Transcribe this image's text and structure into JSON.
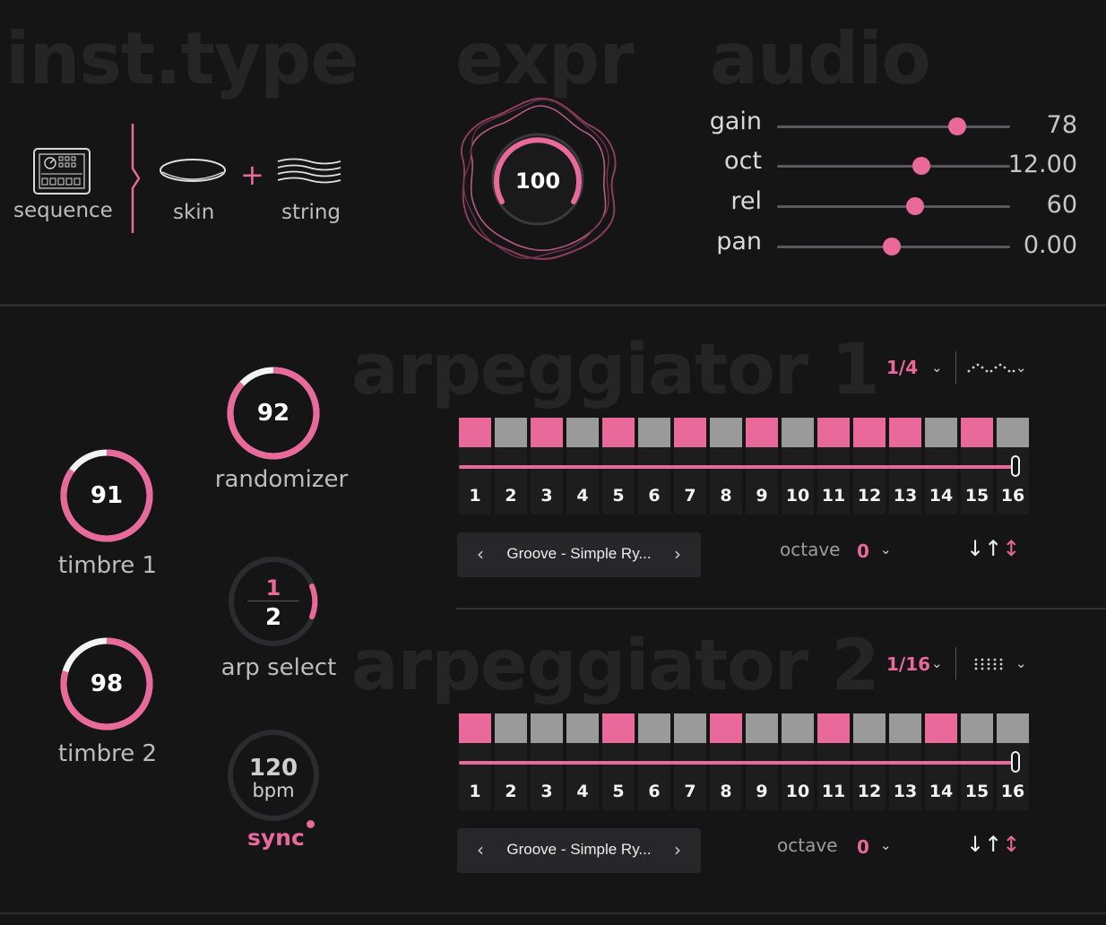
{
  "sections": {
    "inst_type": "inst.type",
    "expr": "expr",
    "audio": "audio",
    "arp1": "arpeggiator 1",
    "arp2": "arpeggiator 2"
  },
  "instrument": {
    "sequence_label": "sequence",
    "skin_label": "skin",
    "plus": "+",
    "string_label": "string"
  },
  "expr": {
    "value": "100"
  },
  "audio": {
    "sliders": [
      {
        "name": "gain",
        "value": "78"
      },
      {
        "name": "oct",
        "value": "12.00"
      },
      {
        "name": "rel",
        "value": "60"
      },
      {
        "name": "pan",
        "value": "0.00"
      }
    ]
  },
  "knobs": {
    "randomizer": {
      "value": "92",
      "label": "randomizer"
    },
    "timbre1": {
      "value": "91",
      "label": "timbre 1"
    },
    "timbre2": {
      "value": "98",
      "label": "timbre 2"
    },
    "arp_select": {
      "top": "1",
      "bottom": "2",
      "label": "arp select"
    },
    "tempo": {
      "value": "120",
      "unit": "bpm",
      "sync_label": "sync"
    }
  },
  "arp1": {
    "rate": "1/4",
    "steps": [
      1,
      0,
      1,
      0,
      1,
      0,
      1,
      0,
      1,
      0,
      1,
      1,
      1,
      0,
      1,
      0
    ],
    "numbers": [
      "1",
      "2",
      "3",
      "4",
      "5",
      "6",
      "7",
      "8",
      "9",
      "10",
      "11",
      "12",
      "13",
      "14",
      "15",
      "16"
    ],
    "preset": "Groove - Simple Ry...",
    "octave_label": "octave",
    "octave_value": "0"
  },
  "arp2": {
    "rate": "1/16",
    "steps": [
      1,
      0,
      0,
      0,
      1,
      0,
      0,
      1,
      0,
      0,
      1,
      0,
      0,
      1,
      0,
      0
    ],
    "numbers": [
      "1",
      "2",
      "3",
      "4",
      "5",
      "6",
      "7",
      "8",
      "9",
      "10",
      "11",
      "12",
      "13",
      "14",
      "15",
      "16"
    ],
    "preset": "Groove - Simple Ry...",
    "octave_label": "octave",
    "octave_value": "0"
  },
  "colors": {
    "accent": "#e9699b",
    "background": "#151516",
    "step_off": "#9a9a9a"
  },
  "icons": {
    "sequence": "sequencer-device-icon",
    "skin": "drum-skin-icon",
    "string": "string-waves-icon",
    "direction": [
      "arrow-down-icon",
      "arrow-up-icon",
      "arrow-updown-icon"
    ]
  }
}
